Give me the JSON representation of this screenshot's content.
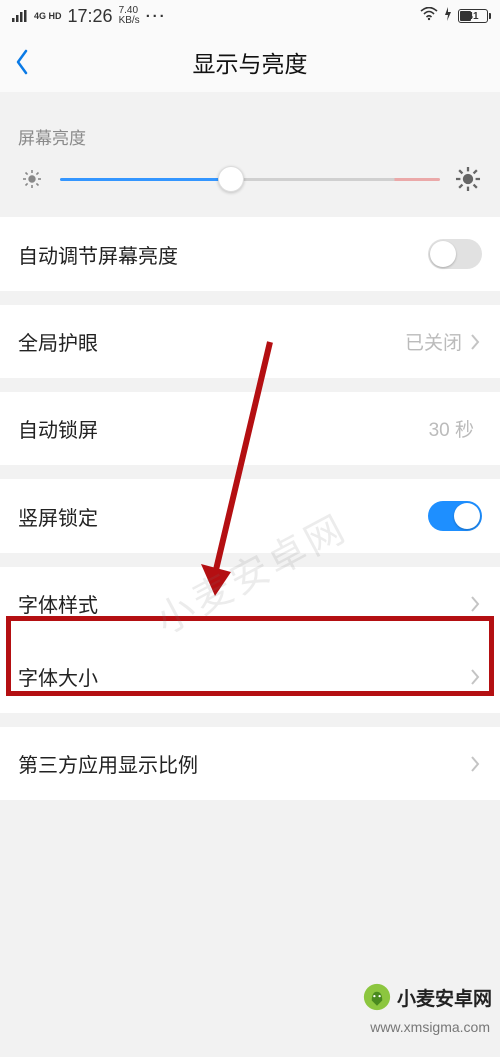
{
  "status": {
    "signal_label": "4G HD",
    "time": "17:26",
    "net_speed_top": "7.40",
    "net_speed_unit": "KB/s",
    "battery_pct": "41"
  },
  "header": {
    "title": "显示与亮度"
  },
  "brightness": {
    "section_label": "屏幕亮度",
    "slider_value_pct": 45
  },
  "rows": {
    "auto_brightness": {
      "label": "自动调节屏幕亮度",
      "on": false
    },
    "eye_protect": {
      "label": "全局护眼",
      "value": "已关闭"
    },
    "auto_lock": {
      "label": "自动锁屏",
      "value": "30 秒"
    },
    "orientation_lock": {
      "label": "竖屏锁定",
      "on": true
    },
    "font_style": {
      "label": "字体样式"
    },
    "font_size": {
      "label": "字体大小"
    },
    "third_party_ratio": {
      "label": "第三方应用显示比例"
    }
  },
  "watermark": {
    "diag": "小麦安卓网",
    "brand": "小麦安卓网",
    "url": "www.xmsigma.com"
  }
}
